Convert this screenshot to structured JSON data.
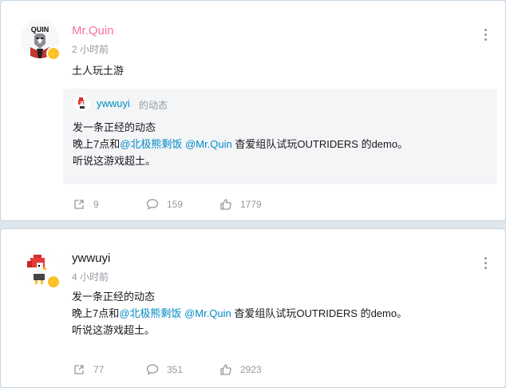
{
  "posts": [
    {
      "author": "Mr.Quin",
      "author_color": "#fb7299",
      "avatar_text": "QUIN",
      "time": "2 小时前",
      "content": "土人玩土游",
      "quote": {
        "author": "ywwuyi",
        "tag": "的动态",
        "line1": "发一条正经的动态",
        "line2_a": "晚上7点和",
        "mention1": "@北极熊剩饭",
        "mention2": "@Mr.Quin",
        "line2_b": " 杳爱组队试玩OUTRIDERS 的demo。",
        "line3": "听说这游戏超土。"
      },
      "actions": {
        "share": "9",
        "comment": "159",
        "like": "1779"
      }
    },
    {
      "author": "ywwuyi",
      "author_color": "#18191c",
      "time": "4 小时前",
      "line1": "发一条正经的动态",
      "line2_a": "晚上7点和",
      "mention1": "@北极熊剩饭",
      "mention2": "@Mr.Quin",
      "line2_b": " 杳爱组队试玩OUTRIDERS 的demo。",
      "line3": "听说这游戏超土。",
      "actions": {
        "share": "77",
        "comment": "351",
        "like": "2923"
      }
    }
  ],
  "icons": {
    "share": "share-icon",
    "comment": "comment-icon",
    "like": "thumbs-up-icon",
    "more": "more-vertical-icon",
    "badge": "lightning-badge-icon"
  },
  "colors": {
    "accent_link": "#008ac5",
    "muted": "#9499a0",
    "badge": "#fbc02d",
    "pink_name": "#fb7299"
  }
}
